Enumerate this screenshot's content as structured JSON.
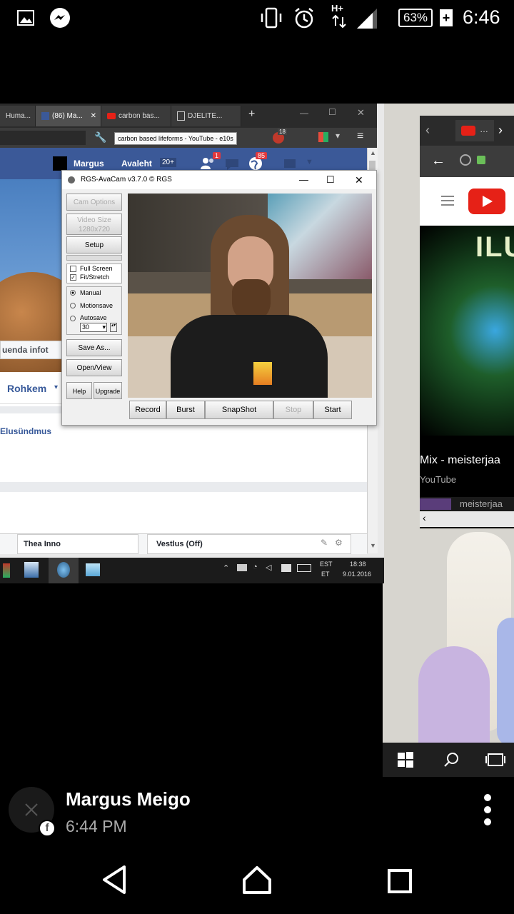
{
  "status_bar": {
    "battery": "63%",
    "time": "6:46",
    "network": "H+"
  },
  "browser": {
    "tabs": [
      "Huma...",
      "(86) Ma...",
      "carbon bas...",
      "DJELITE..."
    ],
    "tooltip": "carbon based lifeforms - YouTube - e10s",
    "notification_badge": "18"
  },
  "facebook": {
    "user": "Margus",
    "home": "Avaleht",
    "home_count": "20+",
    "friend_badge": "1",
    "globe_badge": "85",
    "update_info_button": "uenda infot",
    "more_button": "Rohkem",
    "life_event": "Elusündmus",
    "chat_name": "Thea Inno",
    "chat_status": "Vestlus (Off)"
  },
  "avacam": {
    "title": "RGS-AvaCam v3.7.0 © RGS",
    "cam_options": "Cam Options",
    "video_size": "Video Size 1280x720",
    "setup": "Setup",
    "full_screen": "Full Screen",
    "fit_stretch": "Fit/Stretch",
    "manual": "Manual",
    "motion_save": "Motionsave",
    "autosave": "Autosave",
    "autosave_value": "30",
    "save_as": "Save As...",
    "open_view": "Open/View",
    "help": "Help",
    "upgrade": "Upgrade",
    "record": "Record",
    "burst": "Burst",
    "snapshot": "SnapShot",
    "stop": "Stop",
    "start": "Start"
  },
  "taskbar": {
    "lang_top": "EST",
    "lang_bottom": "ET",
    "time": "18:38",
    "date": "9.01.2016"
  },
  "youtube": {
    "poster_text": "ILUS",
    "video_title": "Mix - meisterjaa",
    "channel": "YouTube",
    "next_item": "meisterjaa"
  },
  "post": {
    "author": "Margus Meigo",
    "time": "6:44 PM"
  }
}
